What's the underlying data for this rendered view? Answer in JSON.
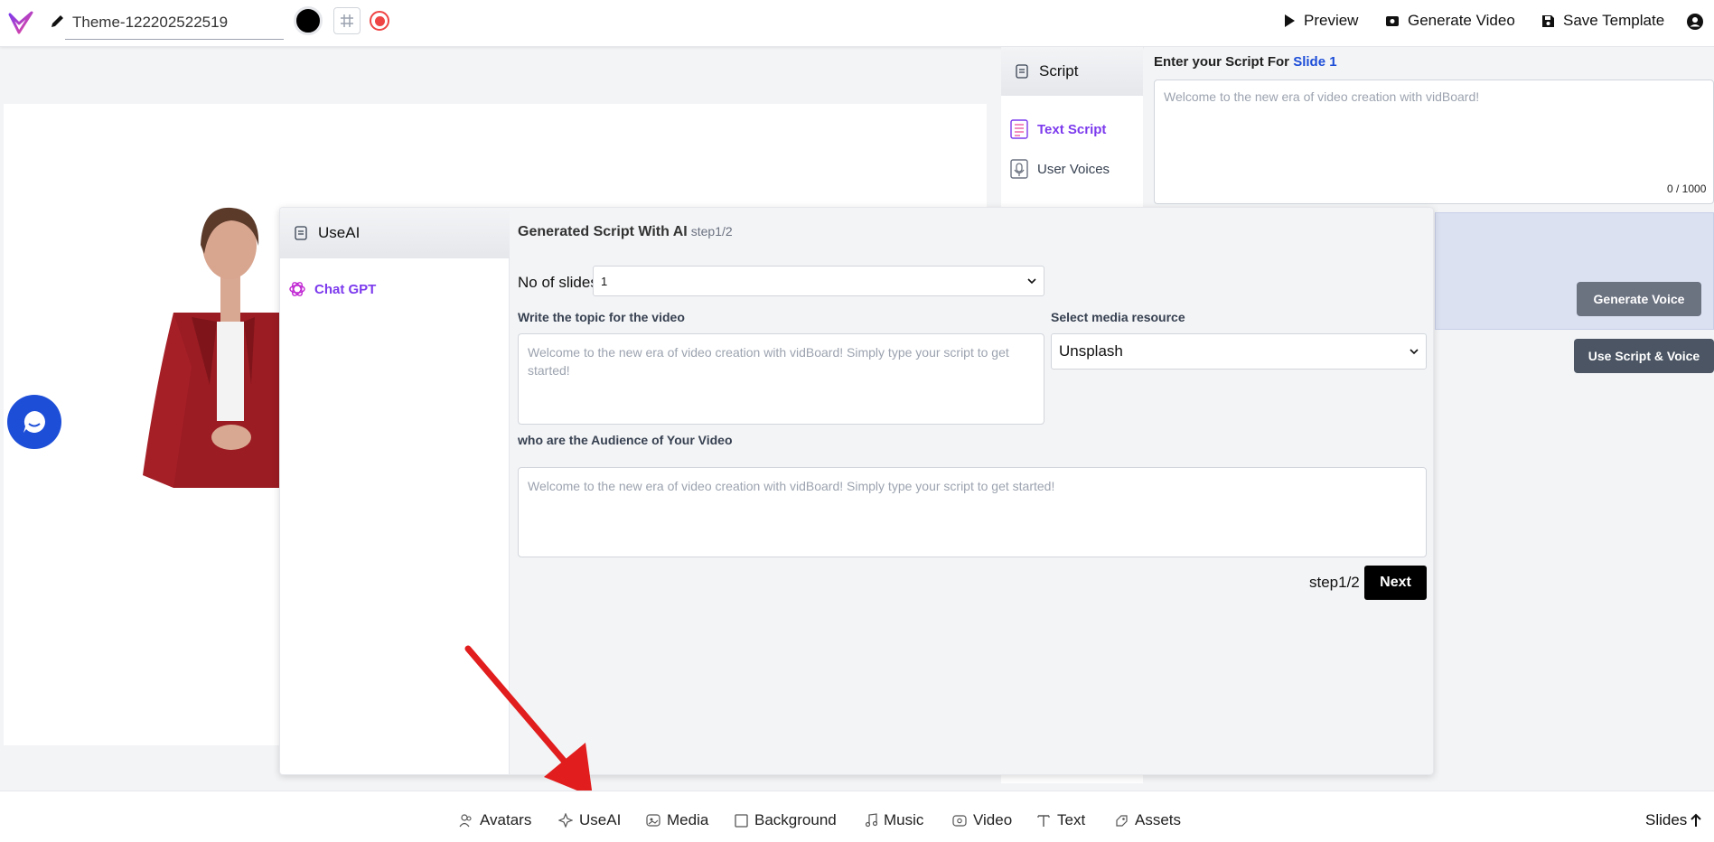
{
  "topbar": {
    "theme_name": "Theme-122202522519",
    "preview_label": "Preview",
    "generate_video_label": "Generate Video",
    "save_template_label": "Save Template"
  },
  "script_panel": {
    "tab_label": "Script",
    "nav": [
      {
        "label": "Text Script",
        "active": true
      },
      {
        "label": "User Voices",
        "active": false
      }
    ],
    "prompt_prefix": "Enter your Script For",
    "prompt_slide": "Slide 1",
    "placeholder": "Welcome to the new era of video creation with vidBoard!",
    "counter": "0 / 1000",
    "generate_voice_label": "Generate Voice",
    "use_script_voice_label": "Use Script & Voice"
  },
  "useai_modal": {
    "tab_label": "UseAI",
    "provider_label": "Chat GPT",
    "title": "Generated Script With AI",
    "title_step": "step1/2",
    "slides_label": "No of slides",
    "slides_value": "1",
    "topic_label": "Write the topic for the video",
    "topic_placeholder": "Welcome to the new era of video creation with vidBoard! Simply type your script to get started!",
    "media_label": "Select media resource",
    "media_value": "Unsplash",
    "audience_label": "who are the Audience of Your Video",
    "audience_placeholder": "Welcome to the new era of video creation with vidBoard! Simply type your script to get started!",
    "footer_step": "step1/2",
    "next_label": "Next"
  },
  "bottombar": {
    "tools": [
      {
        "label": "Avatars",
        "icon": "avatars-icon"
      },
      {
        "label": "UseAI",
        "icon": "sparkle-icon"
      },
      {
        "label": "Media",
        "icon": "media-icon"
      },
      {
        "label": "Background",
        "icon": "square-icon"
      },
      {
        "label": "Music",
        "icon": "music-icon"
      },
      {
        "label": "Video",
        "icon": "video-icon"
      },
      {
        "label": "Text",
        "icon": "text-icon"
      },
      {
        "label": "Assets",
        "icon": "assets-icon"
      }
    ],
    "slides_label": "Slides"
  },
  "colors": {
    "accent": "#7c3aed",
    "link": "#1d4ed8",
    "record": "#ef4444",
    "annotation_arrow": "#e11d1d"
  }
}
